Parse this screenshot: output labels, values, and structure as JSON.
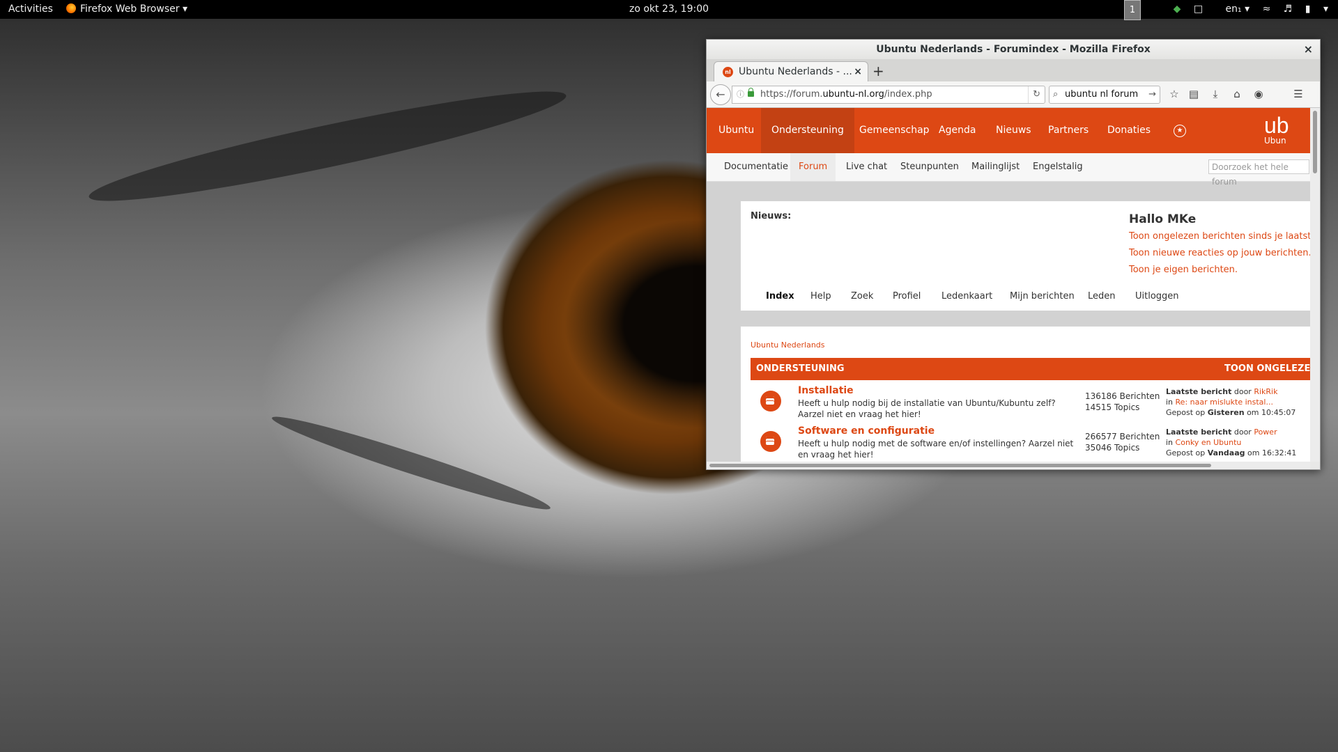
{
  "topbar": {
    "activities": "Activities",
    "app_name": "Firefox Web Browser",
    "clock": "zo okt 23, 19:00",
    "workspace": "1",
    "keyboard": "en₁"
  },
  "window": {
    "title": "Ubuntu Nederlands - Forumindex - Mozilla Firefox",
    "close": "×"
  },
  "tab": {
    "favicon": "nl",
    "title": "Ubuntu Nederlands - ...",
    "close": "×"
  },
  "toolbar": {
    "url_prefix": "https://forum.",
    "url_domain": "ubuntu-nl.org",
    "url_path": "/index.php",
    "search_value": "ubuntu nl forum"
  },
  "mainnav": {
    "items": [
      "Ubuntu",
      "Ondersteuning",
      "Gemeenschap",
      "Agenda",
      "Nieuws",
      "Partners",
      "Donaties"
    ],
    "active": "Ondersteuning",
    "brand_big": "ub",
    "brand_small": "Ubun"
  },
  "subnav": {
    "items": [
      "Documentatie",
      "Forum",
      "Live chat",
      "Steunpunten",
      "Mailinglijst",
      "Engelstalig"
    ],
    "search_placeholder": "Doorzoek het hele forum"
  },
  "news": {
    "label": "Nieuws:",
    "greeting": "Hallo MKe",
    "links": [
      "Toon ongelezen berichten sinds je laatste b",
      "Toon nieuwe reacties op jouw berichten.",
      "Toon je eigen berichten."
    ],
    "forum_nav": [
      "Index",
      "Help",
      "Zoek",
      "Profiel",
      "Ledenkaart",
      "Mijn berichten",
      "Leden",
      "Uitloggen"
    ]
  },
  "forum": {
    "breadcrumb": "Ubuntu Nederlands",
    "category": "ONDERSTEUNING",
    "category_right": "TOON ONGELEZE",
    "boards": [
      {
        "name": "Installatie",
        "desc": "Heeft u hulp nodig bij de installatie van Ubuntu/Kubuntu zelf? Aarzel niet en vraag het hier!",
        "posts": "136186 Berichten",
        "topics": "14515 Topics",
        "last_label": "Laatste bericht",
        "by": "door",
        "author": "RikRik",
        "in": "in",
        "topic": "Re: naar mislukte instal...",
        "posted": "Gepost op",
        "day": "Gisteren",
        "at": "om 10:45:07"
      },
      {
        "name": "Software en configuratie",
        "desc": "Heeft u hulp nodig met de software en/of instellingen? Aarzel niet en vraag het hier!",
        "posts": "266577 Berichten",
        "topics": "35046 Topics",
        "last_label": "Laatste bericht",
        "by": "door",
        "author": "Power",
        "in": "in",
        "topic": "Conky en Ubuntu",
        "posted": "Gepost op",
        "day": "Vandaag",
        "at": "om 16:32:41"
      }
    ]
  },
  "colors": {
    "ubuntu_orange": "#dd4814",
    "topbar": "#000000"
  }
}
